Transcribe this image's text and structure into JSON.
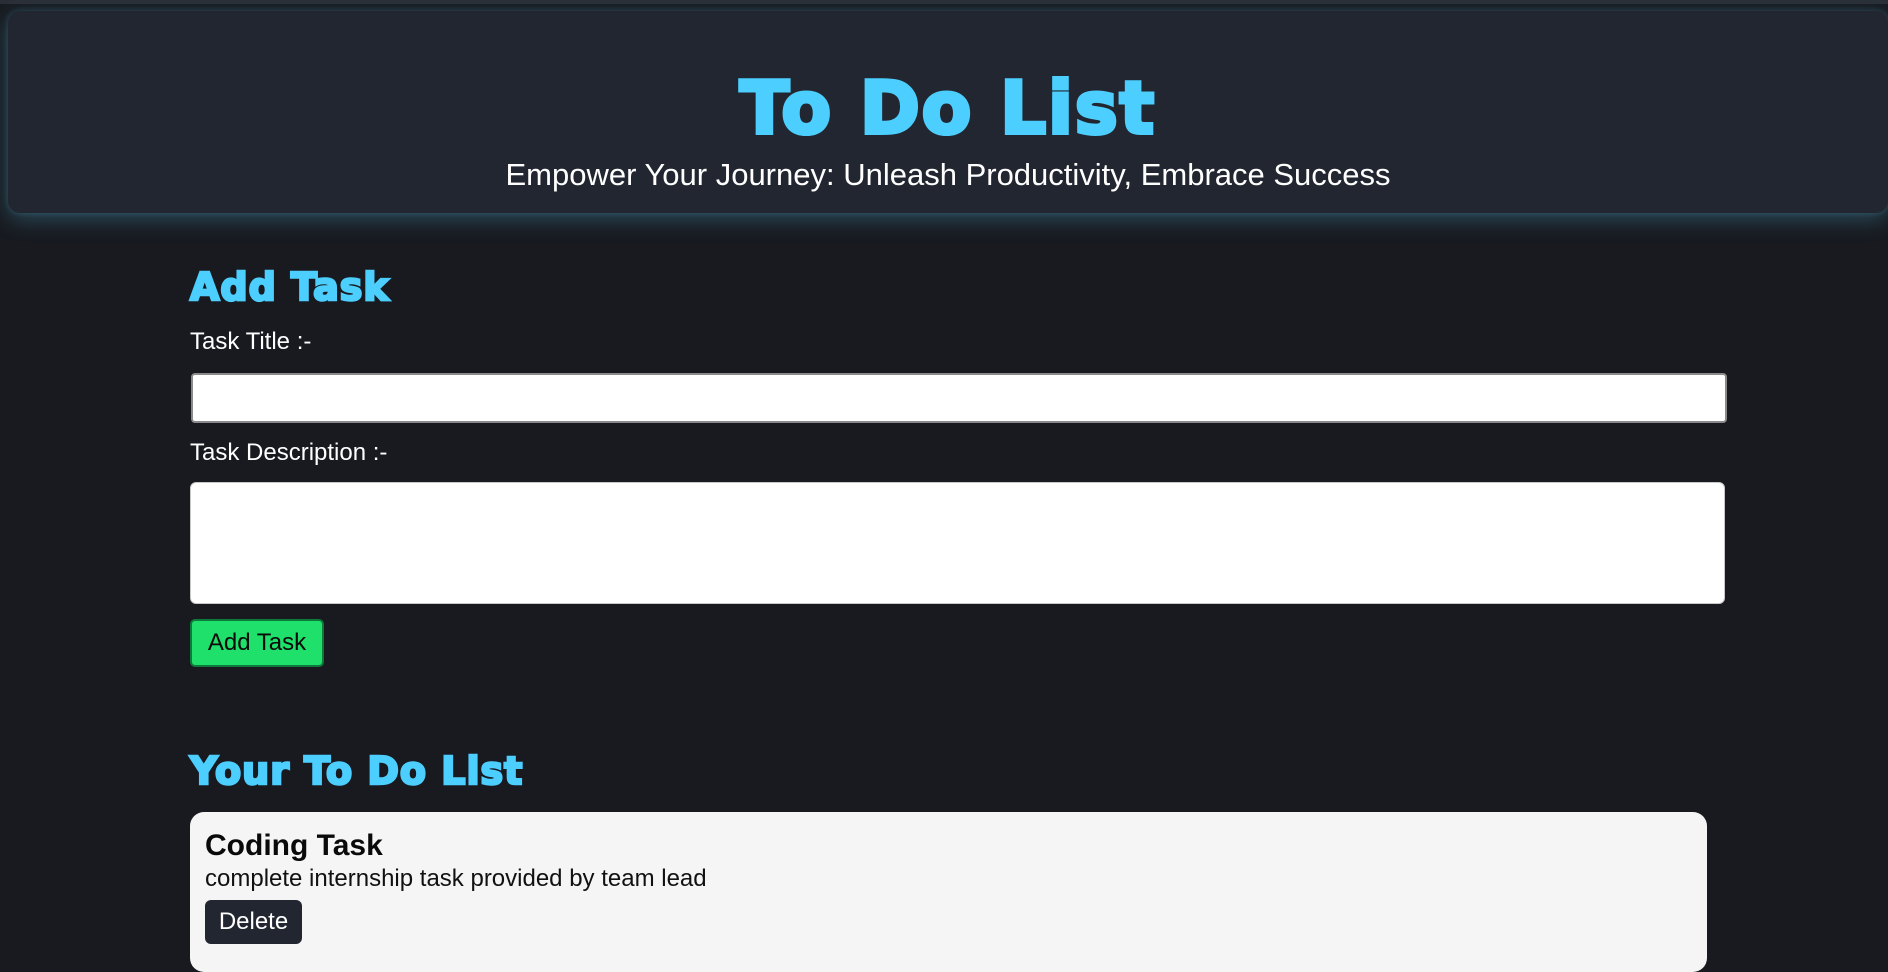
{
  "header": {
    "title": "To Do List",
    "tagline": "Empower Your Journey: Unleash Productivity, Embrace Success"
  },
  "add_section": {
    "heading": "Add Task",
    "title_label": "Task Title :-",
    "title_value": "",
    "description_label": "Task Description :-",
    "description_value": "",
    "add_button_label": "Add Task"
  },
  "list_section": {
    "heading": "Your To Do List",
    "tasks": [
      {
        "title": "Coding Task",
        "description": "complete internship task provided by team lead",
        "delete_label": "Delete"
      }
    ]
  },
  "colors": {
    "page_background": "#181a20",
    "header_background": "#222630",
    "accent": "#4ccfff",
    "add_button": "#1fe06a",
    "card_background": "#f5f5f5"
  }
}
